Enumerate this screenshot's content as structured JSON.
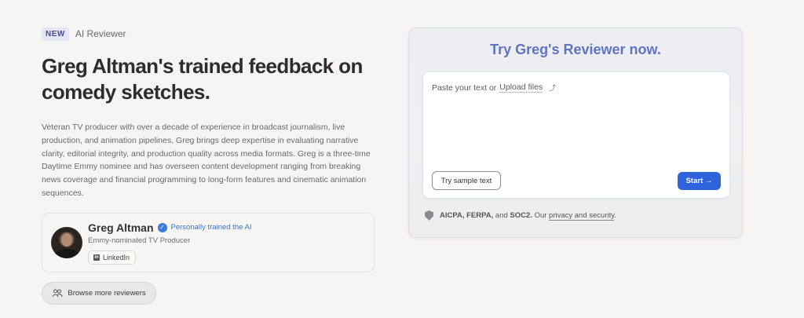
{
  "header": {
    "badge": "NEW",
    "tagline": "AI Reviewer",
    "headline": "Greg Altman's trained feedback on comedy sketches.",
    "bio": "Veteran TV producer with over a decade of experience in broadcast journalism, live production, and animation pipelines, Greg brings deep expertise in evaluating narrative clarity, editorial integrity, and production quality across media formats. Greg is a three-time Daytime Emmy nominee and has overseen content development ranging from breaking news coverage and financial programming to long-form features and cinematic animation sequences."
  },
  "profile": {
    "name": "Greg Altman",
    "verified_label": "Personally trained the AI",
    "role": "Emmy-nominated TV Producer",
    "linkedin_label": "LinkedIn",
    "linkedin_icon": "in"
  },
  "browse": {
    "label": "Browse more reviewers"
  },
  "panel": {
    "title": "Try Greg's Reviewer now.",
    "placeholder_prefix": "Paste your text or",
    "upload_label": "Upload files",
    "upload_icon": "⤴",
    "sample_label": "Try sample text",
    "start_label": "Start →"
  },
  "security": {
    "certs": "AICPA, FERPA,",
    "and": "and",
    "soc": "SOC2.",
    "our": "Our",
    "link": "privacy and security",
    "period": "."
  },
  "colors": {
    "accent": "#2f63dc",
    "title": "#6074c2",
    "verified": "#3d7bdb"
  }
}
